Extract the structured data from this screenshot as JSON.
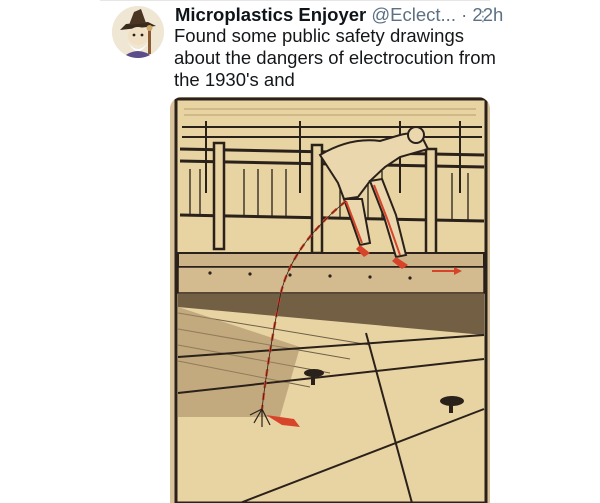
{
  "tweet": {
    "author_name": "Microplastics Enjoyer",
    "handle": "@Eclect...",
    "separator": "·",
    "time": "22h",
    "more_icon": "more-vertical-icon",
    "text_lines": [
      "Found some public safety drawings",
      "about the dangers of electrocution from",
      "the 1930's and"
    ]
  },
  "media": {
    "illustration": "bridge-electrocution-safety-drawing",
    "palette": {
      "paper": "#e8d3a3",
      "ink": "#2a211a",
      "accent": "#d8442a"
    }
  }
}
